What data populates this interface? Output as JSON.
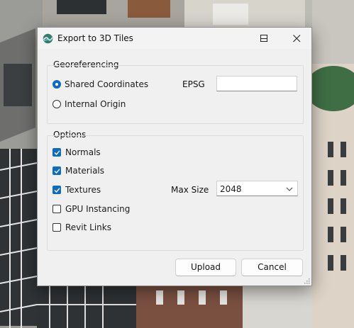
{
  "window": {
    "title": "Export to 3D Tiles",
    "controls": [
      "minimize-icon",
      "maximize-icon",
      "close-icon"
    ]
  },
  "georeferencing": {
    "label": "Georeferencing",
    "options": [
      {
        "label": "Shared Coordinates",
        "selected": true
      },
      {
        "label": "Internal Origin",
        "selected": false
      }
    ],
    "epsg_label": "EPSG",
    "epsg_value": ""
  },
  "options": {
    "label": "Options",
    "items": [
      {
        "label": "Normals",
        "checked": true
      },
      {
        "label": "Materials",
        "checked": true
      },
      {
        "label": "Textures",
        "checked": true
      },
      {
        "label": "GPU Instancing",
        "checked": false
      },
      {
        "label": "Revit Links",
        "checked": false
      }
    ],
    "max_size_label": "Max Size",
    "max_size_value": "2048"
  },
  "buttons": {
    "upload": "Upload",
    "cancel": "Cancel"
  },
  "colors": {
    "accent": "#0f6cbd",
    "dialog_bg": "#f0f0f0"
  }
}
